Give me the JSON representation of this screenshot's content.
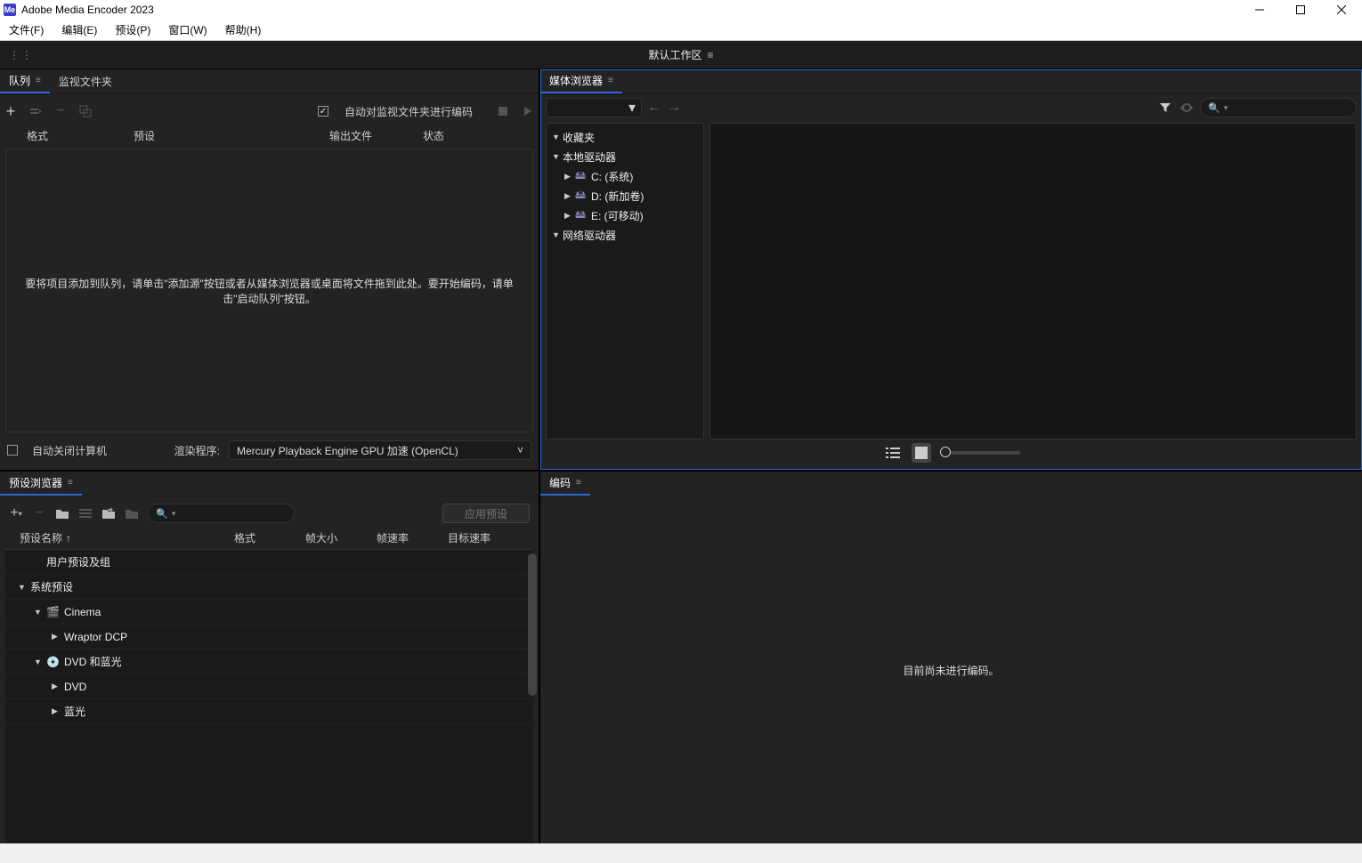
{
  "app": {
    "title": "Adobe Media Encoder 2023",
    "icon_text": "Me"
  },
  "menubar": [
    "文件(F)",
    "编辑(E)",
    "预设(P)",
    "窗口(W)",
    "帮助(H)"
  ],
  "workspace": {
    "label": "默认工作区"
  },
  "panels": {
    "media_browser": {
      "title": "媒体浏览器",
      "search_placeholder": "",
      "tree": {
        "favorites": "收藏夹",
        "local_drives": "本地驱动器",
        "drives": [
          {
            "label": "C: (系统)"
          },
          {
            "label": "D: (新加卷)"
          },
          {
            "label": "E: (可移动)"
          }
        ],
        "network_drives": "网络驱动器"
      }
    },
    "preset_browser": {
      "title": "预设浏览器",
      "headers": {
        "name": "预设名称",
        "format": "格式",
        "framesize": "帧大小",
        "framerate": "帧速率",
        "bitrate": "目标速率"
      },
      "apply_label": "应用预设",
      "rows": [
        {
          "label": "用户预设及组",
          "indent": 1,
          "twist": ""
        },
        {
          "label": "系统预设",
          "indent": 0,
          "twist": "▼"
        },
        {
          "label": "Cinema",
          "indent": 1,
          "twist": "▼",
          "icon": "cinema"
        },
        {
          "label": "Wraptor DCP",
          "indent": 2,
          "twist": "▶"
        },
        {
          "label": "DVD 和蓝光",
          "indent": 1,
          "twist": "▼",
          "icon": "disc"
        },
        {
          "label": "DVD",
          "indent": 2,
          "twist": "▶"
        },
        {
          "label": "蓝光",
          "indent": 2,
          "twist": "▶"
        }
      ]
    },
    "queue": {
      "tab_queue": "队列",
      "tab_watch": "监视文件夹",
      "auto_encode_label": "自动对监视文件夹进行编码",
      "headers": {
        "format": "格式",
        "preset": "预设",
        "output": "输出文件",
        "status": "状态"
      },
      "drop_message": "要将项目添加到队列，请单击\"添加源\"按钮或者从媒体浏览器或桌面将文件拖到此处。要开始编码，请单击\"启动队列\"按钮。",
      "auto_shutdown_label": "自动关闭计算机",
      "renderer_label": "渲染程序:",
      "renderer_value": "Mercury Playback Engine GPU 加速 (OpenCL)"
    },
    "encoding": {
      "title": "编码",
      "idle_message": "目前尚未进行编码。"
    }
  }
}
